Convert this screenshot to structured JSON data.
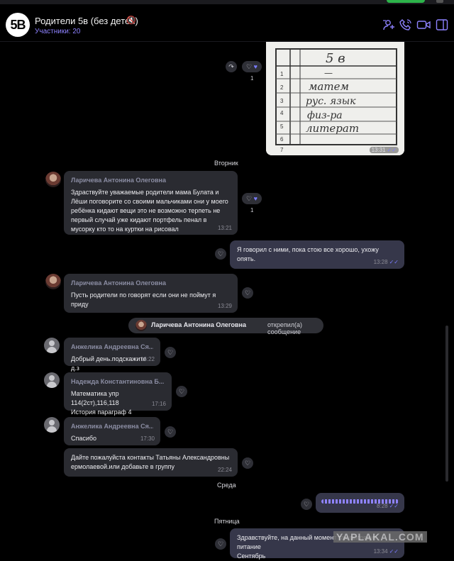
{
  "header": {
    "logo_text": "5В",
    "title": "Родители 5в (без детей)",
    "mute_icon": "🔇",
    "subtitle": "Участники: 20",
    "icons": [
      "add-member-icon",
      "call-icon",
      "video-icon",
      "more-icon"
    ],
    "accent": "#8e82ff"
  },
  "photo_message": {
    "handwritten": [
      "5 в",
      "—",
      "матем",
      "рус. язык",
      "физ-ра",
      "литерат"
    ],
    "row_numbers": [
      "1",
      "2",
      "3",
      "4",
      "5",
      "6",
      "7"
    ],
    "time": "13:31",
    "reaction_count": "1"
  },
  "days": {
    "tuesday": "Вторник",
    "wednesday": "Среда",
    "friday": "Пятница"
  },
  "messages": [
    {
      "sender": "Ларичева Антонина Олеговна",
      "text": "Здраствуйте уважаемые родители мама Булата и Лёши поговорите со своими мальчиками они у моего ребёнка кидают вещи это не возможно терпеть не первый случай уже кидают портфель пенал в мусорку кто то на куртки на рисовал",
      "time": "13:21",
      "reaction_count": "1"
    },
    {
      "text": "Я говорил с ними, пока стою все хорошо, ухожу опять.",
      "time": "13:28"
    },
    {
      "sender": "Ларичева Антонина Олеговна",
      "text": "Пусть родители по говорят если они не поймут я приду",
      "time": "13:29"
    },
    {
      "sender": "Анжелика Андреевна Ся...",
      "text": "Добрый день.подскажите д.з",
      "time": "16:22"
    },
    {
      "sender": "Надежда Константиновна Б...",
      "text_line1": "Математика упр 114(2ст),116,118",
      "text_line2": "История параграф 4",
      "time": "17:16"
    },
    {
      "sender": "Анжелика Андреевна Ся...",
      "text": "Спасибо",
      "time": "17:30"
    },
    {
      "text": "Дайте пожалуйста контакты Татьяны Александровны ермолаевой.или добавьте в группу",
      "time": "22:24"
    },
    {
      "time": "8:28"
    },
    {
      "text_line1": "Здравствуйте, на данный момент так выглядит питание",
      "text_line2": "Сентябрь",
      "time": "13:34"
    }
  ],
  "pinned": {
    "name": "Ларичева Антонина Олеговна",
    "action": "открепил(а) сообщение"
  },
  "ticks": "✓✓",
  "watermark": "YAPLAKAL.COM"
}
